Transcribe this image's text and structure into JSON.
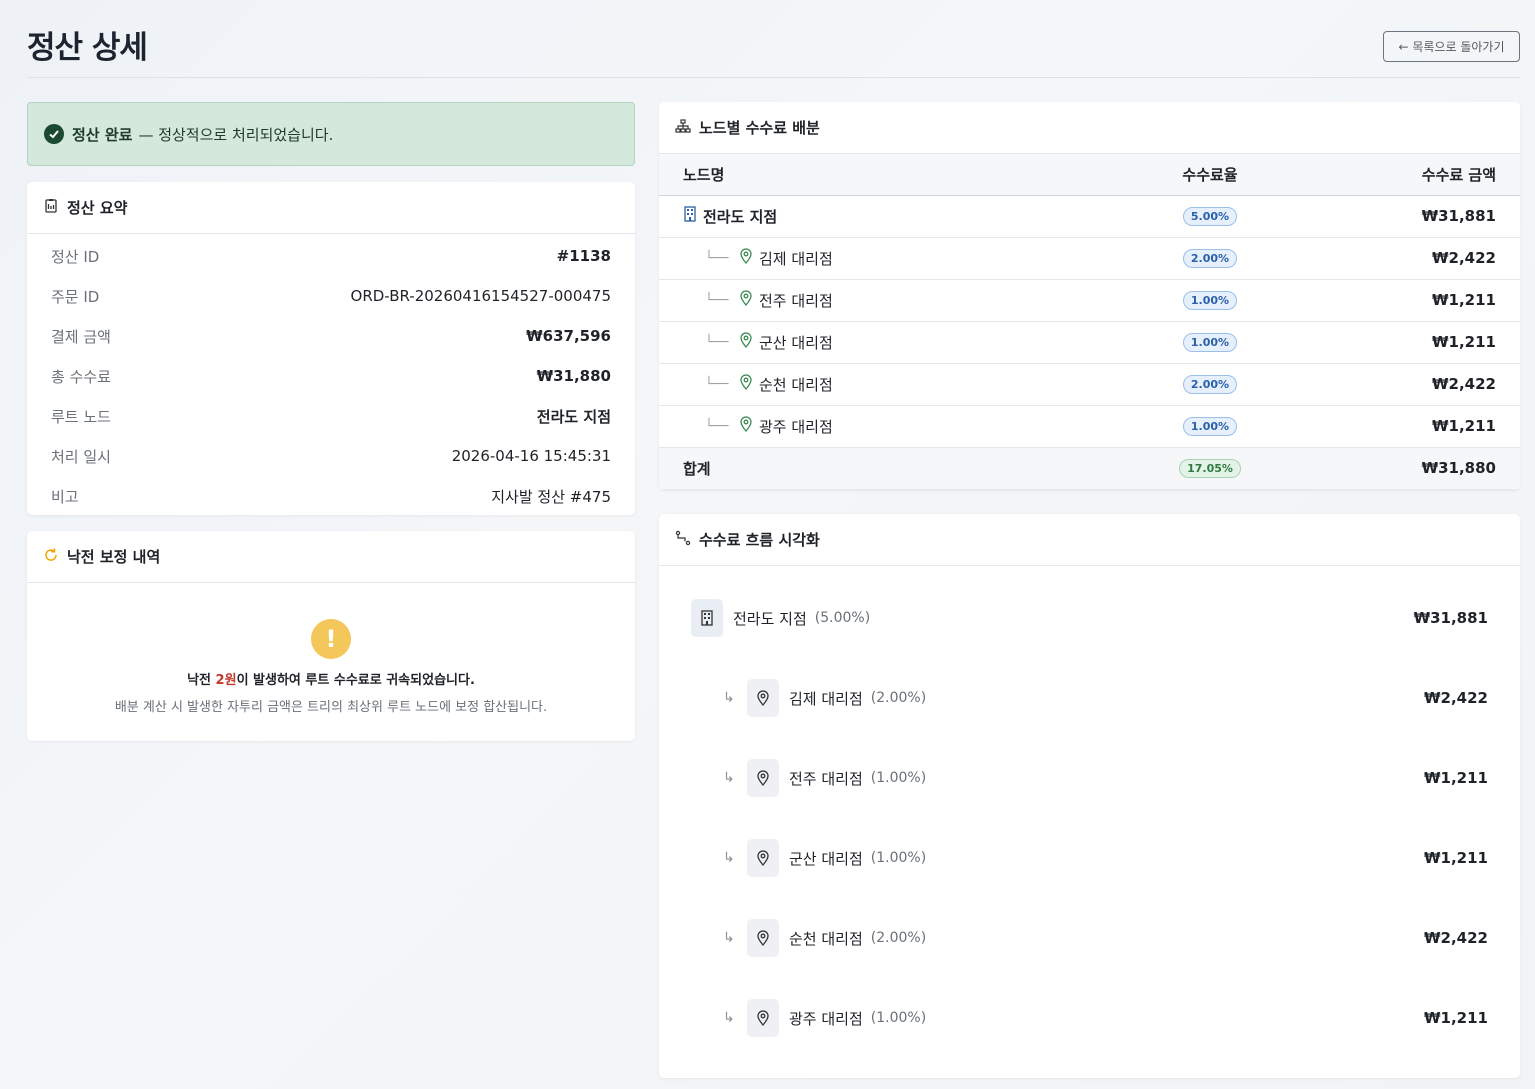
{
  "header": {
    "title": "정산 상세",
    "back_label": "← 목록으로 돌아가기"
  },
  "alert": {
    "strong": "정산 완료",
    "message": "— 정상적으로 처리되었습니다."
  },
  "summary": {
    "title": "정산 요약",
    "rows": [
      {
        "key": "정산 ID",
        "value": "#1138"
      },
      {
        "key": "주문 ID",
        "value": "ORD-BR-20260416154527-000475"
      },
      {
        "key": "결제 금액",
        "value": "₩637,596"
      },
      {
        "key": "총 수수료",
        "value": "₩31,880"
      },
      {
        "key": "루트 노드",
        "value": "전라도 지점"
      },
      {
        "key": "처리 일시",
        "value": "2026-04-16 15:45:31"
      },
      {
        "key": "비고",
        "value": "지사발 정산 #475"
      }
    ]
  },
  "rounding": {
    "title": "낙전 보정 내역",
    "line1_prefix": "낙전 ",
    "line1_amount": "2원",
    "line1_suffix": "이 발생하여 루트 수수료로 귀속되었습니다.",
    "line2": "배분 계산 시 발생한 자투리 금액은 트리의 최상위 루트 노드에 보정 합산됩니다."
  },
  "distribution": {
    "title": "노드별 수수료 배분",
    "columns": {
      "node": "노드명",
      "rate": "수수료율",
      "amount": "수수료 금액"
    },
    "rows": [
      {
        "name": "전라도 지점",
        "rate": "5.00%",
        "amount": "₩31,881"
      },
      {
        "name": "김제 대리점",
        "rate": "2.00%",
        "amount": "₩2,422"
      },
      {
        "name": "전주 대리점",
        "rate": "1.00%",
        "amount": "₩1,211"
      },
      {
        "name": "군산 대리점",
        "rate": "1.00%",
        "amount": "₩1,211"
      },
      {
        "name": "순천 대리점",
        "rate": "2.00%",
        "amount": "₩2,422"
      },
      {
        "name": "광주 대리점",
        "rate": "1.00%",
        "amount": "₩1,211"
      }
    ],
    "total": {
      "label": "합계",
      "rate": "17.05%",
      "amount": "₩31,880"
    },
    "tree_glyph": "└──"
  },
  "flow": {
    "title": "수수료 흐름 시각화",
    "root": {
      "name": "전라도 지점",
      "pct": "(5.00%)",
      "amount": "₩31,881"
    },
    "children": [
      {
        "name": "김제 대리점",
        "pct": "(2.00%)",
        "amount": "₩2,422"
      },
      {
        "name": "전주 대리점",
        "pct": "(1.00%)",
        "amount": "₩1,211"
      },
      {
        "name": "군산 대리점",
        "pct": "(1.00%)",
        "amount": "₩1,211"
      },
      {
        "name": "순천 대리점",
        "pct": "(2.00%)",
        "amount": "₩2,422"
      },
      {
        "name": "광주 대리점",
        "pct": "(1.00%)",
        "amount": "₩1,211"
      }
    ],
    "arrow_glyph": "↳"
  },
  "colors": {
    "accent_blue": "#2b5fa8",
    "success_bg": "#d4e8dc",
    "pin_green": "#3a8a55",
    "warn": "#f4c75a",
    "red": "#c0392b"
  },
  "icons": [
    "check-circle-icon",
    "receipt-icon",
    "refresh-icon",
    "sitemap-icon",
    "flow-icon",
    "building-icon",
    "map-pin-icon",
    "warning-icon",
    "arrow-left-icon"
  ]
}
